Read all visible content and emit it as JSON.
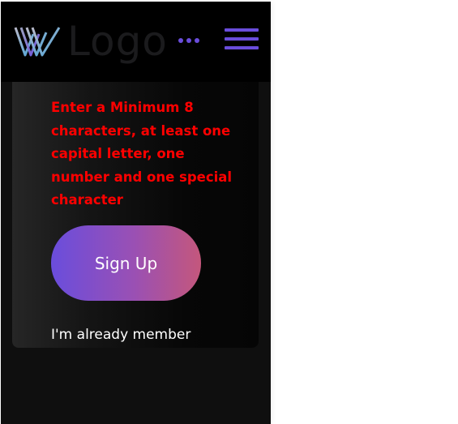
{
  "header": {
    "logo_text": "Logo",
    "more_icon": "more-dots-icon",
    "menu_icon": "hamburger-menu-icon"
  },
  "form": {
    "error_message": "Enter a Minimum 8 characters, at least one capital letter, one number and one special character",
    "signup_label": "Sign Up",
    "member_link": "I'm already member"
  },
  "colors": {
    "accent": "#6a4ddc",
    "error": "#ff0000",
    "button_gradient_start": "#6a4ddc",
    "button_gradient_end": "#c4577c",
    "header_bg": "#000000",
    "page_bg": "#0f0f0f"
  }
}
